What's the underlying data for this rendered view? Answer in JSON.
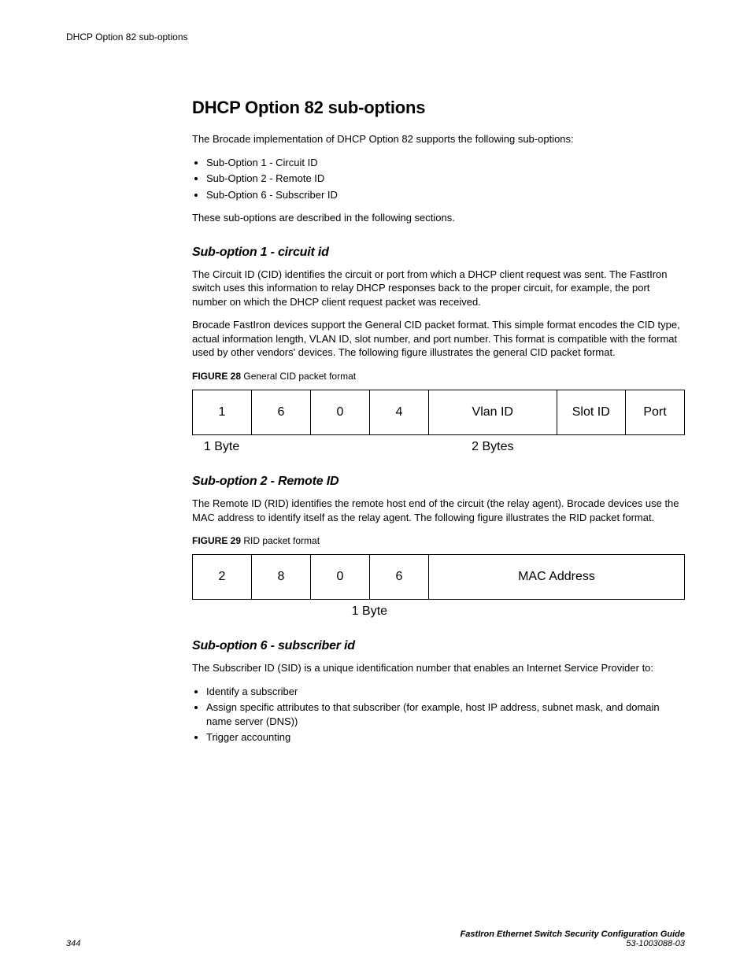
{
  "header": {
    "running": "DHCP Option 82 sub-options"
  },
  "title": "DHCP Option 82 sub-options",
  "intro": "The Brocade implementation of DHCP Option 82 supports the following sub-options:",
  "intro_bullets": [
    "Sub-Option 1 - Circuit ID",
    "Sub-Option 2 - Remote ID",
    "Sub-Option 6 - Subscriber ID"
  ],
  "intro_outro": "These sub-options are described in the following sections.",
  "s1": {
    "head": "Sub-option 1 - circuit id",
    "p1": "The Circuit ID (CID) identifies the circuit or port from which a DHCP client request was sent. The FastIron switch uses this information to relay DHCP responses back to the proper circuit, for example, the port number on which the DHCP client request packet was received.",
    "p2": "Brocade FastIron devices support the General CID packet format. This simple format encodes the CID type, actual information length, VLAN ID, slot number, and port number. This format is compatible with the format used by other vendors' devices. The following figure illustrates the general CID packet format.",
    "fig_label": "FIGURE 28",
    "fig_caption": "General CID packet format",
    "cells": [
      "1",
      "6",
      "0",
      "4",
      "Vlan ID",
      "Slot ID",
      "Port"
    ],
    "sub_left": "1 Byte",
    "sub_right": "2 Bytes"
  },
  "s2": {
    "head": "Sub-option 2 - Remote ID",
    "p1": "The Remote ID (RID) identifies the remote host end of the circuit (the relay agent). Brocade devices use the MAC address to identify itself as the relay agent. The following figure illustrates the RID packet format.",
    "fig_label": "FIGURE 29",
    "fig_caption": "RID packet format",
    "cells": [
      "2",
      "8",
      "0",
      "6",
      "MAC Address"
    ],
    "sub": "1 Byte"
  },
  "s3": {
    "head": "Sub-option 6 - subscriber id",
    "p1": "The Subscriber ID (SID) is a unique identification number that enables an Internet Service Provider to:",
    "bullets": [
      "Identify a subscriber",
      "Assign specific attributes to that subscriber (for example, host IP address, subnet mask, and domain name server (DNS))",
      "Trigger accounting"
    ]
  },
  "footer": {
    "page": "344",
    "book": "FastIron Ethernet Switch Security Configuration Guide",
    "docnum": "53-1003088-03"
  }
}
